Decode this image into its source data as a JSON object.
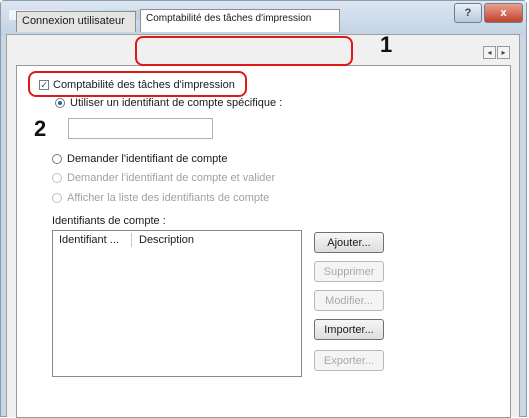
{
  "window": {
    "help_label": "?",
    "close_label": "x"
  },
  "tabs": [
    {
      "label": "Connexion utilisateur"
    },
    {
      "label": "Comptabilité des tâches d'impression"
    }
  ],
  "tab_scroll": {
    "left": "◂",
    "right": "▸"
  },
  "settings": {
    "job_accounting_checkbox": {
      "label": "Comptabilité des tâches d'impression",
      "checked": true
    },
    "radio_specific": {
      "label": "Utiliser un identifiant de compte spécifique :",
      "checked": true
    },
    "account_id_value": "",
    "radio_prompt": {
      "label": "Demander l'identifiant de compte",
      "checked": false
    },
    "radio_prompt_validate": {
      "label": "Demander l'identifiant de compte et valider",
      "checked": false
    },
    "radio_show_list": {
      "label": "Afficher la liste des identifiants de compte",
      "checked": false
    }
  },
  "accounts": {
    "label": "Identifiants de compte :",
    "columns": [
      "Identifiant ...",
      "Description"
    ],
    "rows": []
  },
  "buttons": {
    "add": "Ajouter...",
    "delete": "Supprimer",
    "modify": "Modifier...",
    "import": "Importer...",
    "export": "Exporter..."
  },
  "callouts": {
    "one": "1",
    "two": "2"
  },
  "colors": {
    "callout": "#e01818",
    "radio_accent": "#2b5fa8"
  }
}
